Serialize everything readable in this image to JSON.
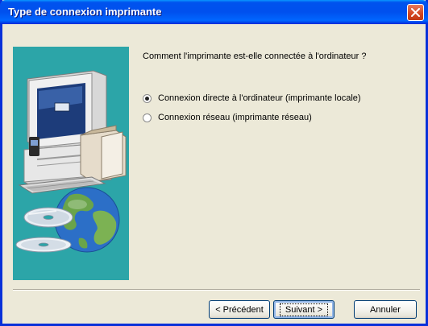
{
  "window": {
    "title": "Type de connexion imprimante"
  },
  "content": {
    "question": "Comment l'imprimante est-elle connectée à l'ordinateur ?",
    "options": [
      {
        "label": "Connexion directe à l'ordinateur (imprimante locale)",
        "selected": true
      },
      {
        "label": "Connexion réseau (imprimante réseau)",
        "selected": false
      }
    ]
  },
  "buttons": {
    "back": "< Précédent",
    "next": "Suivant >",
    "cancel": "Annuler"
  },
  "colors": {
    "illustration_bg": "#2ca5a8",
    "titlebar": "#0053ee",
    "dialog_bg": "#ece9d8"
  },
  "icons": {
    "close": "close-icon",
    "computer": "computer-icon",
    "globe": "globe-icon",
    "cd": "cd-icon"
  }
}
